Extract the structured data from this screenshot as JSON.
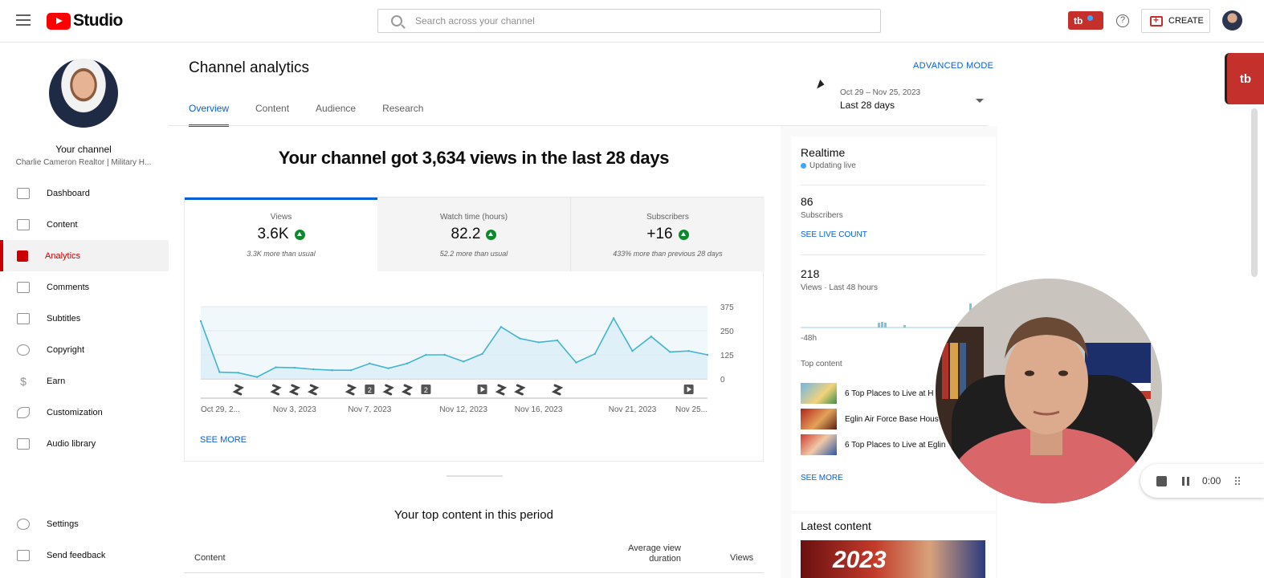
{
  "app": {
    "title": "Studio"
  },
  "search": {
    "placeholder": "Search across your channel"
  },
  "header": {
    "extension_label": "tb",
    "create_label": "CREATE",
    "help": "?"
  },
  "channel": {
    "heading": "Your channel",
    "name": "Charlie Cameron Realtor | Military H..."
  },
  "sidebar": {
    "items": [
      {
        "label": "Dashboard",
        "icon": "dashboard-icon"
      },
      {
        "label": "Content",
        "icon": "content-icon"
      },
      {
        "label": "Analytics",
        "icon": "analytics-icon",
        "active": true
      },
      {
        "label": "Comments",
        "icon": "comments-icon"
      },
      {
        "label": "Subtitles",
        "icon": "subtitles-icon"
      },
      {
        "label": "Copyright",
        "icon": "copyright-icon"
      },
      {
        "label": "Earn",
        "icon": "earn-icon"
      },
      {
        "label": "Customization",
        "icon": "customization-icon"
      },
      {
        "label": "Audio library",
        "icon": "audio-library-icon"
      }
    ],
    "bottom": [
      {
        "label": "Settings",
        "icon": "gear-icon"
      },
      {
        "label": "Send feedback",
        "icon": "feedback-icon"
      }
    ]
  },
  "page": {
    "title": "Channel analytics",
    "advanced_mode": "ADVANCED MODE",
    "tabs": [
      "Overview",
      "Content",
      "Audience",
      "Research"
    ],
    "date_range": "Oct 29 – Nov 25, 2023",
    "period": "Last 28 days",
    "headline": "Your channel got 3,634 views in the last 28 days"
  },
  "metrics": [
    {
      "label": "Views",
      "value": "3.6K",
      "note": "3.3K more than usual"
    },
    {
      "label": "Watch time (hours)",
      "value": "82.2",
      "note": "52.2 more than usual"
    },
    {
      "label": "Subscribers",
      "value": "+16",
      "note": "433% more than previous 28 days"
    }
  ],
  "chart_data": {
    "type": "area",
    "series": [
      {
        "values": [
          300,
          35,
          32,
          10,
          60,
          58,
          50,
          45,
          45,
          80,
          55,
          80,
          125,
          125,
          90,
          130,
          270,
          210,
          190,
          200,
          85,
          130,
          315,
          145,
          220,
          140,
          145,
          125
        ]
      }
    ],
    "x_tick_labels": [
      "Oct 29, 2...",
      "Nov 3, 2023",
      "Nov 7, 2023",
      "Nov 12, 2023",
      "Nov 16, 2023",
      "Nov 21, 2023",
      "Nov 25..."
    ],
    "x_tick_index": [
      0,
      5,
      9,
      14,
      18,
      23,
      27
    ],
    "y_ticks": [
      0,
      125,
      250,
      375
    ],
    "ylim": [
      0,
      375
    ],
    "grid": true,
    "markers": [
      {
        "index": 2,
        "kind": "short"
      },
      {
        "index": 4,
        "kind": "short"
      },
      {
        "index": 5,
        "kind": "short"
      },
      {
        "index": 6,
        "kind": "short"
      },
      {
        "index": 8,
        "kind": "short"
      },
      {
        "index": 9,
        "kind": "count",
        "text": "2"
      },
      {
        "index": 10,
        "kind": "short"
      },
      {
        "index": 11,
        "kind": "short"
      },
      {
        "index": 12,
        "kind": "count",
        "text": "2"
      },
      {
        "index": 15,
        "kind": "video"
      },
      {
        "index": 16,
        "kind": "short"
      },
      {
        "index": 17,
        "kind": "short"
      },
      {
        "index": 19,
        "kind": "short"
      },
      {
        "index": 26,
        "kind": "video"
      }
    ]
  },
  "see_more": "SEE MORE",
  "top_content": {
    "title": "Your top content in this period",
    "col_content": "Content",
    "col_avd": "Average view duration",
    "col_views": "Views"
  },
  "realtime": {
    "title": "Realtime",
    "status": "Updating live",
    "subscribers_value": "86",
    "subscribers_label": "Subscribers",
    "see_live_count": "SEE LIVE COUNT",
    "views_value": "218",
    "views_label": "Views · Last 48 hours",
    "axis_start": "-48h",
    "top_content_label": "Top content",
    "items": [
      "6 Top Places to Live at H",
      "Eglin Air Force Base Hous",
      "6 Top Places to Live at Eglin"
    ],
    "see_more": "SEE MORE"
  },
  "latest": {
    "title": "Latest content",
    "thumb_text": "2023"
  },
  "recorder": {
    "time": "0:00"
  },
  "colors": {
    "accent": "#065fd4",
    "brand": "#ff0000",
    "active_nav": "#cc0000",
    "chart_line": "#41b4d2",
    "up": "#0a8a2a"
  }
}
